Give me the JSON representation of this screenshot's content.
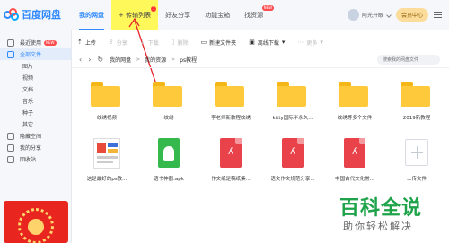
{
  "app": {
    "logo_text": "百度网盘"
  },
  "nav": {
    "items": [
      {
        "label": "我的网盘"
      },
      {
        "label": "+ 传输列表",
        "dot": "1"
      },
      {
        "label": "好友分享"
      },
      {
        "label": "功能宝箱"
      },
      {
        "label": "找资源",
        "badge": "NEW"
      }
    ]
  },
  "user": {
    "name": "阿光开眼",
    "vip_label": "会员中心"
  },
  "sidebar": {
    "items": [
      {
        "label": "最近使用",
        "badge": "NEW"
      },
      {
        "label": "全部文件"
      },
      {
        "label": "图片"
      },
      {
        "label": "视频"
      },
      {
        "label": "文档"
      },
      {
        "label": "音乐"
      },
      {
        "label": "种子"
      },
      {
        "label": "其它"
      },
      {
        "label": "隐藏空间"
      },
      {
        "label": "我的分享"
      },
      {
        "label": "回收站"
      }
    ]
  },
  "toolbar": {
    "upload": "上传",
    "share": "分享",
    "download": "下载",
    "delete": "删除",
    "new_folder": "新建文件夹",
    "offline": "离线下载",
    "more": "更多"
  },
  "path": {
    "crumbs": [
      "我的网盘",
      "我的资源",
      "ps教程"
    ],
    "search_placeholder": "搜索我的网盘文件"
  },
  "files": [
    {
      "name": "纹绣视频",
      "type": "folder"
    },
    {
      "name": "纹绣",
      "type": "folder"
    },
    {
      "name": "李老师新教程纹绣",
      "type": "folder"
    },
    {
      "name": "kitty国际半永久...",
      "type": "folder"
    },
    {
      "name": "纹绣等多个文件",
      "type": "folder"
    },
    {
      "name": "2019新教程",
      "type": "folder"
    },
    {
      "name": "这是最好的ps教...",
      "type": "image"
    },
    {
      "name": "语书神器.apk",
      "type": "apk"
    },
    {
      "name": "作文纸是稿纸集...",
      "type": "pdf"
    },
    {
      "name": "语文作文规范分享...",
      "type": "pdf"
    },
    {
      "name": "中国古代文化常...",
      "type": "pdf"
    },
    {
      "name": "上传文件",
      "type": "upload"
    }
  ],
  "watermark": {
    "title": "百科全说",
    "subtitle": "助你轻松解决"
  }
}
